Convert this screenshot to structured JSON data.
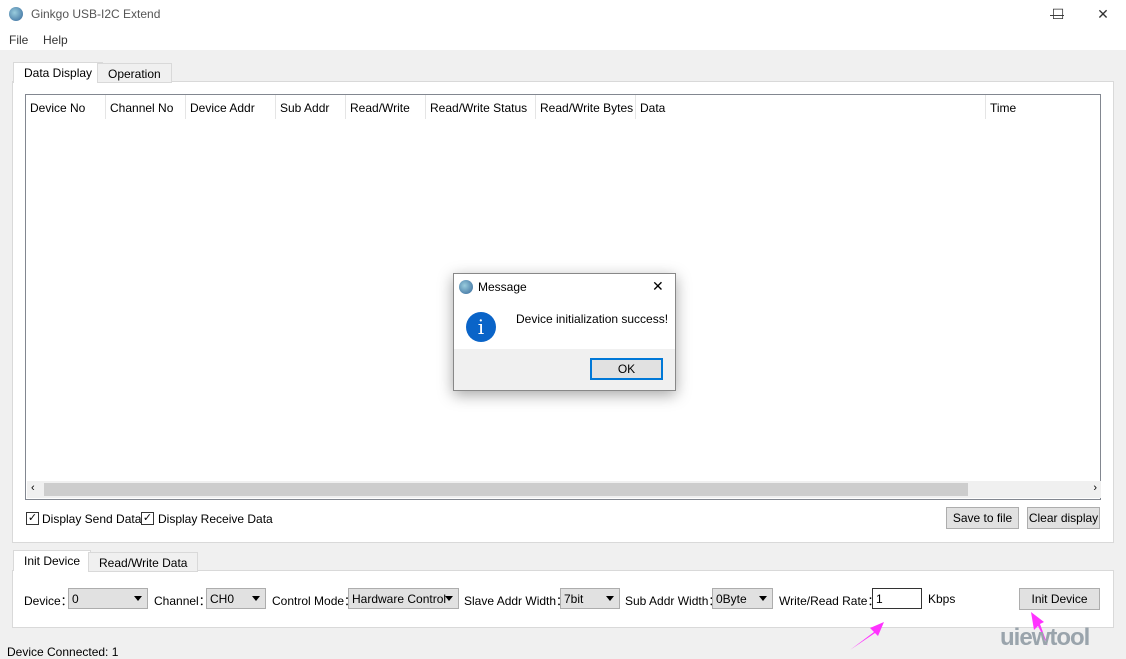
{
  "window": {
    "title": "Ginkgo USB-I2C Extend",
    "minimize": "—",
    "maximize": "☐",
    "close": "✕"
  },
  "menu": [
    "File",
    "Help"
  ],
  "top_tabs": [
    "Data Display",
    "Operation"
  ],
  "table": {
    "columns": [
      "Device No",
      "Channel No",
      "Device Addr",
      "Sub Addr",
      "Read/Write",
      "Read/Write Status",
      "Read/Write Bytes",
      "Data",
      "Time"
    ],
    "rows": []
  },
  "options": {
    "display_send": "Display Send Data",
    "display_send_checked": true,
    "display_receive": "Display Receive Data",
    "display_receive_checked": true,
    "save": "Save to file",
    "clear": "Clear display"
  },
  "bottom_tabs": [
    "Init Device",
    "Read/Write Data"
  ],
  "init": {
    "device_label": "Device：",
    "device": "0",
    "channel_label": "Channel：",
    "channel": "CH0",
    "mode_label": "Control Mode：",
    "mode": "Hardware Control",
    "slave_label": "Slave Addr Width：",
    "slave": "7bit",
    "sub_label": "Sub Addr Width：",
    "sub": "0Byte",
    "rate_label": "Write/Read Rate：",
    "rate": "1",
    "rate_unit": "Kbps",
    "init_button": "Init Device"
  },
  "status": "Device Connected: 1",
  "dialog": {
    "title": "Message",
    "message": "Device initialization success!",
    "ok": "OK",
    "icon": "info-icon",
    "close": "✕"
  },
  "watermark": "uiewtool",
  "colors": {
    "accent": "#0078d7",
    "arrow": "#ff33ff"
  }
}
